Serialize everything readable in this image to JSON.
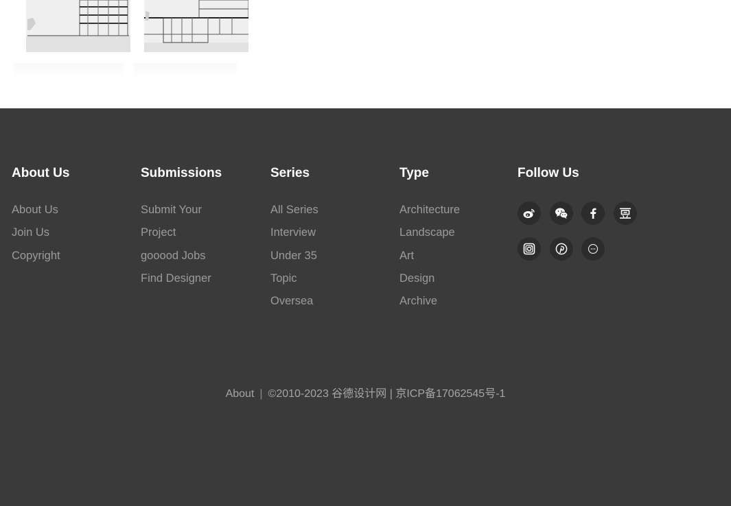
{
  "footer": {
    "columns": [
      {
        "title": "About Us",
        "links": [
          "About Us",
          "Join Us",
          "Copyright"
        ]
      },
      {
        "title": "Submissions",
        "links": [
          "Submit Your",
          "Project",
          "gooood Jobs",
          "Find Designer"
        ]
      },
      {
        "title": "Series",
        "links": [
          "All Series",
          "Interview",
          "Under 35",
          "Topic",
          "Oversea"
        ]
      },
      {
        "title": "Type",
        "links": [
          "Architecture",
          "Landscape",
          "Art",
          "Design",
          "Archive"
        ]
      }
    ],
    "follow": {
      "title": "Follow Us",
      "icons": [
        {
          "name": "weibo-icon"
        },
        {
          "name": "wechat-icon"
        },
        {
          "name": "facebook-icon",
          "glyph": "f"
        },
        {
          "name": "douban-icon",
          "glyph": "豆"
        },
        {
          "name": "instagram-icon"
        },
        {
          "name": "pinterest-icon"
        },
        {
          "name": "app-icon"
        }
      ]
    },
    "bottom": {
      "about_link": "About",
      "separator": "|",
      "copyright": "©2010-2023 谷德设计网 | 京ICP备17062545号-1"
    }
  },
  "colors": {
    "footer_bg": "#3a3a3a",
    "heading": "#ffffff",
    "link": "#9b9b9b",
    "icon_bg": "#2c2c2c"
  }
}
